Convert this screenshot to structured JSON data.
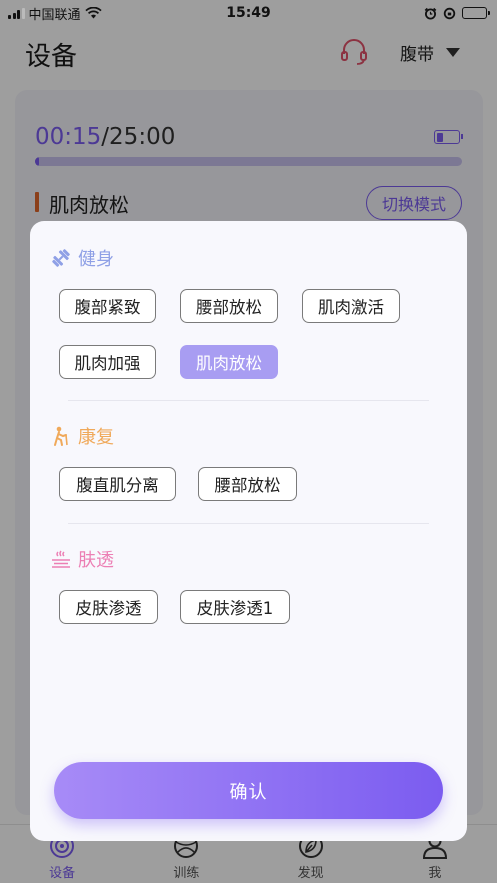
{
  "status_bar": {
    "carrier": "中国联通",
    "time": "15:49",
    "battery_level": 0.55
  },
  "header": {
    "title": "设备",
    "headset_icon": "headset-icon",
    "device_name": "腹带"
  },
  "player": {
    "elapsed": "00:15",
    "separator": "/",
    "total": "25:00",
    "progress": 0.01,
    "battery_level": 0.3,
    "mode_title": "肌肉放松",
    "switch_label": "切换模式"
  },
  "modal": {
    "sections": [
      {
        "title": "健身",
        "icon": "dumbbell-icon",
        "color": "#8fa0e6",
        "items": [
          "腹部紧致",
          "腰部放松",
          "肌肉激活",
          "肌肉加强",
          "肌肉放松"
        ],
        "selected": "肌肉放松"
      },
      {
        "title": "康复",
        "icon": "rehab-figure-icon",
        "color": "#f0a95a",
        "items": [
          "腹直肌分离",
          "腰部放松"
        ]
      },
      {
        "title": "肤透",
        "icon": "skin-icon",
        "color": "#ec7fb4",
        "items": [
          "皮肤渗透",
          "皮肤渗透1"
        ]
      }
    ],
    "confirm_label": "确认"
  },
  "tabbar": {
    "tabs": [
      {
        "label": "设备",
        "icon": "device-signal-icon",
        "active": true
      },
      {
        "label": "训练",
        "icon": "training-ball-icon",
        "active": false
      },
      {
        "label": "发现",
        "icon": "discover-leaf-icon",
        "active": false
      },
      {
        "label": "我",
        "icon": "profile-icon",
        "active": false
      }
    ]
  },
  "colors": {
    "accent": "#7b5cf0",
    "selected_chip": "#a89df2",
    "mode_bar": "#e0662b"
  }
}
